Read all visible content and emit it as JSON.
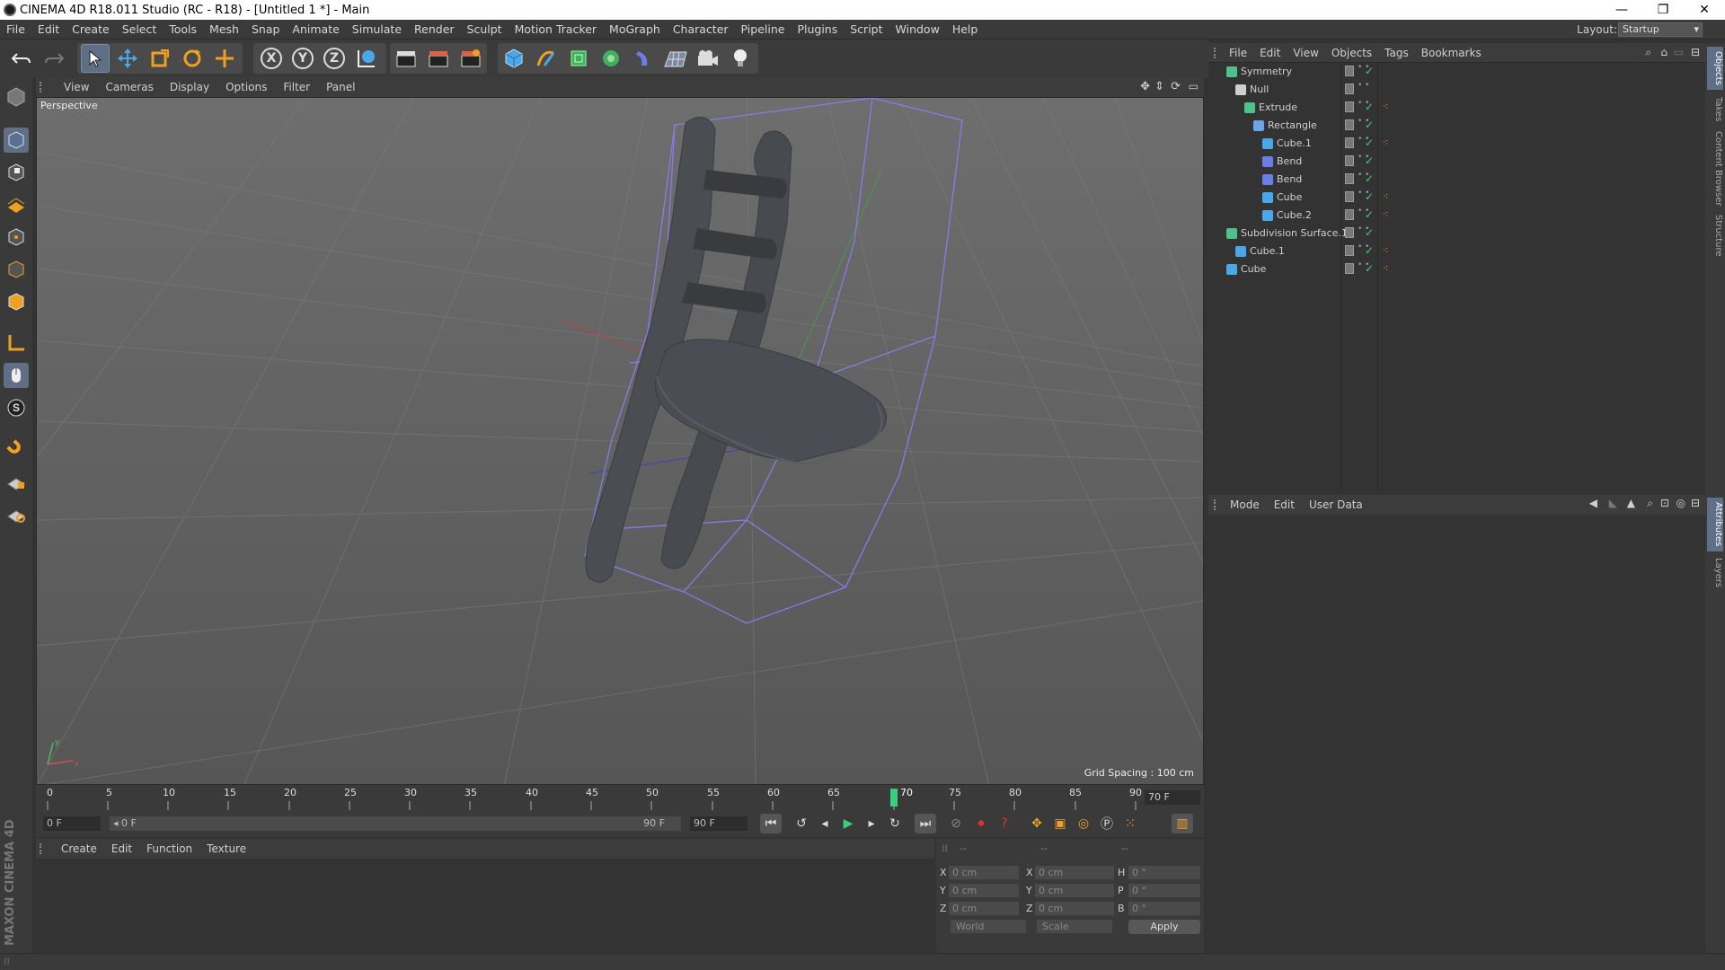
{
  "window": {
    "title": "CINEMA 4D R18.011 Studio (RC - R18) - [Untitled 1 *] - Main",
    "minimize": "—",
    "restore": "❐",
    "close": "✕"
  },
  "menubar": {
    "items": [
      "File",
      "Edit",
      "Create",
      "Select",
      "Tools",
      "Mesh",
      "Snap",
      "Animate",
      "Simulate",
      "Render",
      "Sculpt",
      "Motion Tracker",
      "MoGraph",
      "Character",
      "Pipeline",
      "Plugins",
      "Script",
      "Window",
      "Help"
    ],
    "layout_label": "Layout:",
    "layout_value": "Startup"
  },
  "toolbar": {
    "axis_x": "X",
    "axis_y": "Y",
    "axis_z": "Z"
  },
  "viewport": {
    "menu": [
      "View",
      "Cameras",
      "Display",
      "Options",
      "Filter",
      "Panel"
    ],
    "label": "Perspective",
    "grid_spacing": "Grid Spacing : 100 cm",
    "axis_x_label": "x",
    "axis_y_label": "y"
  },
  "timeline": {
    "ticks": [
      "0",
      "5",
      "10",
      "15",
      "20",
      "25",
      "30",
      "35",
      "40",
      "45",
      "50",
      "55",
      "60",
      "65",
      "70",
      "75",
      "80",
      "85",
      "90"
    ],
    "current_frame": "70 F",
    "current_frame_value": 70,
    "max_frame_value": 90,
    "start_field": "0 F",
    "range_start": "◂ 0 F",
    "range_end": "90 F",
    "end_field": "90 F"
  },
  "material_manager": {
    "menu": [
      "Create",
      "Edit",
      "Function",
      "Texture"
    ]
  },
  "coordinates": {
    "col_headers": [
      "--",
      "--",
      "--"
    ],
    "rows": [
      {
        "axis": "X",
        "pos": "0 cm",
        "saxis": "X",
        "size": "0 cm",
        "raxis": "H",
        "rot": "0 °"
      },
      {
        "axis": "Y",
        "pos": "0 cm",
        "saxis": "Y",
        "size": "0 cm",
        "raxis": "P",
        "rot": "0 °"
      },
      {
        "axis": "Z",
        "pos": "0 cm",
        "saxis": "Z",
        "size": "0 cm",
        "raxis": "B",
        "rot": "0 °"
      }
    ],
    "space": "World",
    "mode": "Scale",
    "apply": "Apply"
  },
  "object_manager": {
    "menu": [
      "File",
      "Edit",
      "View",
      "Objects",
      "Tags",
      "Bookmarks"
    ],
    "objects": [
      {
        "name": "Symmetry",
        "color": "#4fc28a",
        "tag": false,
        "check": true
      },
      {
        "name": "Null",
        "color": "#cfcfcf",
        "tag": false,
        "check": false
      },
      {
        "name": "Extrude",
        "color": "#4fc28a",
        "tag": true,
        "check": true
      },
      {
        "name": "Rectangle",
        "color": "#6aa6e6",
        "tag": false,
        "check": true
      },
      {
        "name": "Cube.1",
        "color": "#4aa8e8",
        "tag": true,
        "check": true
      },
      {
        "name": "Bend",
        "color": "#6a7ee6",
        "tag": false,
        "check": true
      },
      {
        "name": "Bend",
        "color": "#6a7ee6",
        "tag": false,
        "check": true
      },
      {
        "name": "Cube",
        "color": "#4aa8e8",
        "tag": true,
        "check": true
      },
      {
        "name": "Cube.2",
        "color": "#4aa8e8",
        "tag": true,
        "check": true
      },
      {
        "name": "Subdivision Surface.1",
        "color": "#4fc28a",
        "tag": false,
        "check": true
      },
      {
        "name": "Cube.1",
        "color": "#4aa8e8",
        "tag": true,
        "check": true
      },
      {
        "name": "Cube",
        "color": "#4aa8e8",
        "tag": true,
        "check": true
      }
    ]
  },
  "attribute_manager": {
    "menu": [
      "Mode",
      "Edit",
      "User Data"
    ]
  },
  "side_tabs": [
    "Objects",
    "Takes",
    "Content Browser",
    "Structure",
    "Attributes",
    "Layers"
  ],
  "branding": "MAXON CINEMA 4D"
}
